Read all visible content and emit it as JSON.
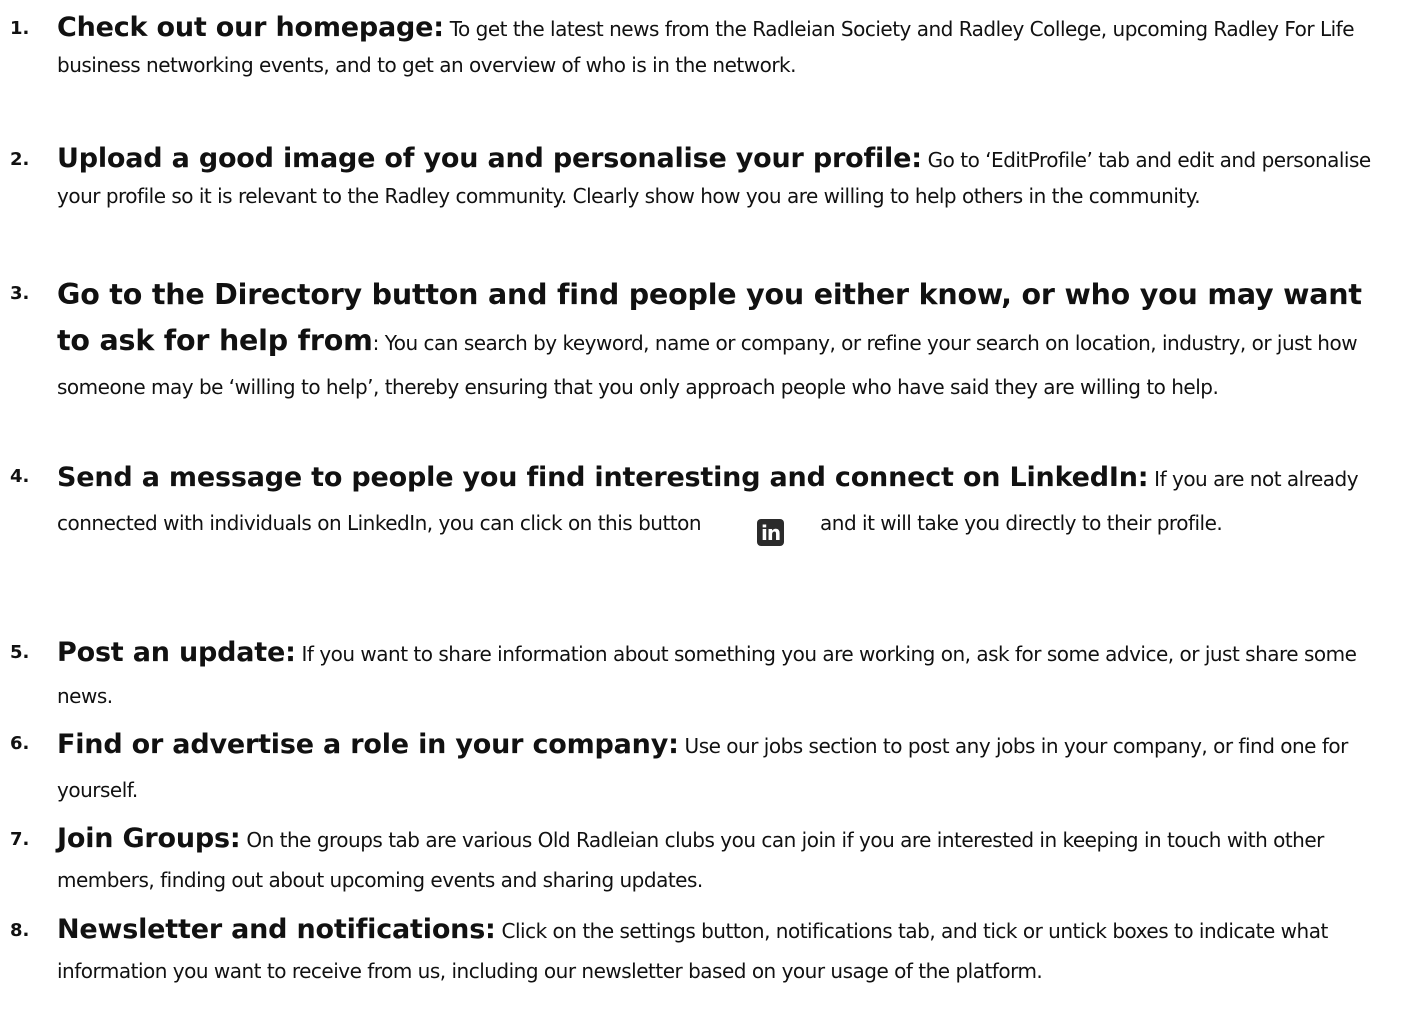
{
  "items": [
    {
      "number": "1.",
      "heading": "Check out our homepage:",
      "text": " To get the latest news from the Radleian Society and Radley College, upcoming Radley For Life business networking events, and to get an overview of who is in the network."
    },
    {
      "number": "2.",
      "heading": "Upload a good image of you and personalise your profile:",
      "text": " Go to ‘EditProfile’ tab and edit and personalise your profile so it is relevant to the Radley community.  Clearly show how you are willing to help others in the community."
    },
    {
      "number": "3.",
      "heading": "Go to the Directory button and find people you either know, or who you may want to ask for help from",
      "text": ": You can search by keyword, name or company, or refine your search on location, industry, or just how someone may be ‘willing to help’, thereby ensuring that you only approach people who have said they are willing to help."
    },
    {
      "number": "4.",
      "heading": "Send a message to people you find interesting and connect on LinkedIn:",
      "text_before_icon": " If you are not already connected with individuals on LinkedIn, you can click on this button",
      "icon": "linkedin-icon",
      "icon_glyph": "in",
      "text_after_icon": "and it will take you directly to their profile."
    },
    {
      "number": "5.",
      "heading": "Post an update:",
      "text": " If you want to share information about something you are working on, ask for some advice, or just share some news."
    },
    {
      "number": "6.",
      "heading": "Find or advertise a role in your company:",
      "text": " Use our jobs section to post any jobs in your company, or find one for yourself."
    },
    {
      "number": "7.",
      "heading": "Join Groups:",
      "text": " On the groups tab are various Old Radleian clubs you can join if you are interested in keeping in touch with other members, finding out about upcoming events and sharing updates."
    },
    {
      "number": "8.",
      "heading": "Newsletter and notifications:",
      "text": "  Click on the settings button, notifications tab, and tick or untick boxes to indicate what information you want to receive from us, including our newsletter based on your usage of the platform."
    }
  ]
}
